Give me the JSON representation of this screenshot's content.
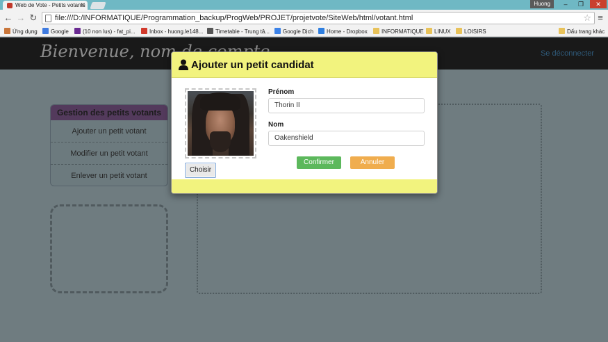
{
  "browser": {
    "tab_title": "Web de Vote - Petits votants",
    "url": "file:///D:/INFORMATIQUE/Programmation_backup/ProgWeb/PROJET/projetvote/SiteWeb/html/votant.html",
    "user": "Huong",
    "bookmarks": [
      {
        "label": "Ứng dụng",
        "icon": "apps-icon"
      },
      {
        "label": "Google",
        "icon": "google-icon"
      },
      {
        "label": "(10 non lus) - fat_pi...",
        "icon": "yahoo-mail-icon"
      },
      {
        "label": "Inbox - huong.le148...",
        "icon": "gmail-icon"
      },
      {
        "label": "Timetable - Trung tâ...",
        "icon": "page-icon"
      },
      {
        "label": "Google Dịch",
        "icon": "google-translate-icon"
      },
      {
        "label": "Home - Dropbox",
        "icon": "dropbox-icon"
      },
      {
        "label": "INFORMATIQUE",
        "icon": "folder-icon"
      },
      {
        "label": "LINUX",
        "icon": "folder-icon"
      },
      {
        "label": "LOISIRS",
        "icon": "folder-icon"
      }
    ],
    "other_bookmarks": "Dấu trang khác"
  },
  "header": {
    "welcome": "Bienvenue, nom de compte",
    "logout": "Se déconnecter"
  },
  "sidebar": {
    "title": "Gestion des petits votants",
    "items": [
      {
        "label": "Ajouter un petit votant"
      },
      {
        "label": "Modifier un petit votant"
      },
      {
        "label": "Enlever un petit votant"
      }
    ]
  },
  "modal": {
    "title": "Ajouter un petit candidat",
    "choose_button": "Choisir",
    "first_name_label": "Prénom",
    "first_name_value": "Thorin II",
    "last_name_label": "Nom",
    "last_name_value": "Oakenshield",
    "confirm_button": "Confirmer",
    "cancel_button": "Annuler"
  },
  "colors": {
    "modal_header": "#f2f37e",
    "confirm": "#5cb85c",
    "cancel": "#f0ad4e",
    "sidebar_title": "#533a5c"
  }
}
